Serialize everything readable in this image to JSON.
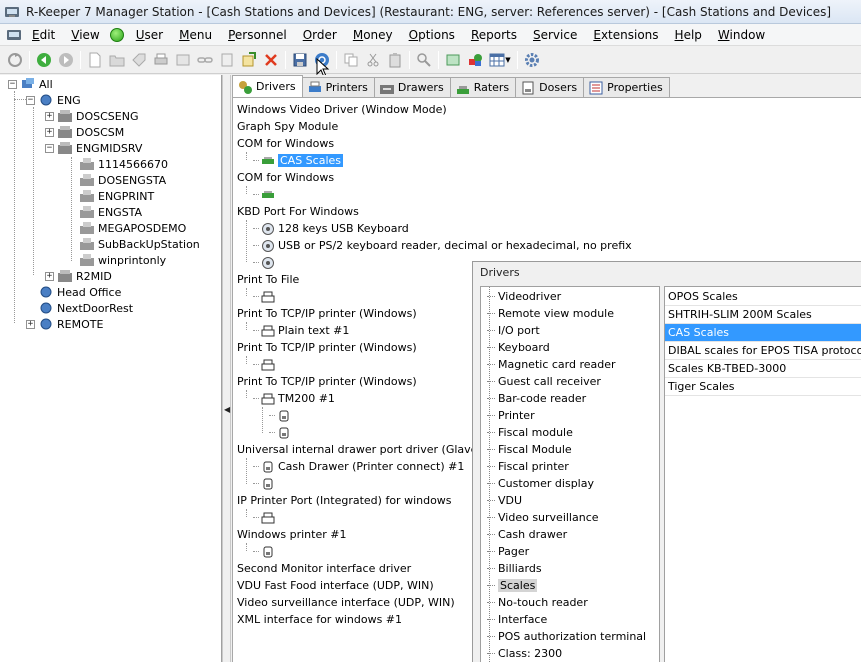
{
  "window": {
    "title": "R-Keeper 7 Manager Station - [Cash Stations and Devices] (Restaurant: ENG, server: References server) - [Cash Stations and Devices]"
  },
  "menu": [
    "Edit",
    "View",
    "User",
    "Menu",
    "Personnel",
    "Order",
    "Money",
    "Options",
    "Reports",
    "Service",
    "Extensions",
    "Help",
    "Window"
  ],
  "tree": {
    "root": "All",
    "nodes": [
      {
        "label": "ENG",
        "level": 1
      },
      {
        "label": "DOSCSENG",
        "level": 2
      },
      {
        "label": "DOSCSM",
        "level": 2
      },
      {
        "label": "ENGMIDSRV",
        "level": 2
      },
      {
        "label": "1114566670",
        "level": 3
      },
      {
        "label": "DOSENGSTA",
        "level": 3
      },
      {
        "label": "ENGPRINT",
        "level": 3
      },
      {
        "label": "ENGSTA",
        "level": 3
      },
      {
        "label": "MEGAPOSDEMO",
        "level": 3
      },
      {
        "label": "SubBackUpStation",
        "level": 3
      },
      {
        "label": "winprintonly",
        "level": 3
      },
      {
        "label": "R2MID",
        "level": 2
      },
      {
        "label": "Head Office",
        "level": 1
      },
      {
        "label": "NextDoorRest",
        "level": 1
      },
      {
        "label": "REMOTE",
        "level": 1
      }
    ]
  },
  "tabs": [
    "Drivers",
    "Printers",
    "Drawers",
    "Raters",
    "Dosers",
    "Properties"
  ],
  "drivers": [
    {
      "label": "Windows Video Driver (Window Mode)",
      "indent": 0
    },
    {
      "label": "Graph Spy Module",
      "indent": 0
    },
    {
      "label": "COM for Windows",
      "indent": 0
    },
    {
      "label": "CAS Scales",
      "indent": 1,
      "icon": "scale",
      "selected": true
    },
    {
      "label": "COM for Windows",
      "indent": 0
    },
    {
      "label": "",
      "indent": 1,
      "icon": "scale"
    },
    {
      "label": "KBD Port For Windows",
      "indent": 0
    },
    {
      "label": "128 keys USB Keyboard",
      "indent": 1,
      "icon": "keyboard"
    },
    {
      "label": "USB or PS/2 keyboard reader, decimal or hexadecimal, no prefix",
      "indent": 1,
      "icon": "keyboard"
    },
    {
      "label": "",
      "indent": 1,
      "icon": "keyboard"
    },
    {
      "label": "Print To File",
      "indent": 0
    },
    {
      "label": "",
      "indent": 1,
      "icon": "printer"
    },
    {
      "label": "Print To TCP/IP printer (Windows)",
      "indent": 0
    },
    {
      "label": "Plain text #1",
      "indent": 1,
      "icon": "printer"
    },
    {
      "label": "Print To TCP/IP printer (Windows)",
      "indent": 0
    },
    {
      "label": "",
      "indent": 1,
      "icon": "printer"
    },
    {
      "label": "Print To TCP/IP printer (Windows)",
      "indent": 0
    },
    {
      "label": "TM200 #1",
      "indent": 1,
      "icon": "printer"
    },
    {
      "label": "",
      "indent": 2,
      "icon": "drawer"
    },
    {
      "label": "",
      "indent": 2,
      "icon": "drawer"
    },
    {
      "label": "Universal internal drawer port driver (Glave, etc.)",
      "indent": 0
    },
    {
      "label": "Cash Drawer (Printer connect) #1",
      "indent": 1,
      "icon": "drawer"
    },
    {
      "label": "",
      "indent": 1,
      "icon": "drawer"
    },
    {
      "label": "IP Printer Port (Integrated) for windows",
      "indent": 0
    },
    {
      "label": "",
      "indent": 1,
      "icon": "printer"
    },
    {
      "label": "Windows printer #1",
      "indent": 0
    },
    {
      "label": "",
      "indent": 1,
      "icon": "drawer"
    },
    {
      "label": "Second Monitor interface driver",
      "indent": 0
    },
    {
      "label": "VDU Fast Food interface (UDP, WIN)",
      "indent": 0
    },
    {
      "label": "Video surveillance interface (UDP, WIN)",
      "indent": 0
    },
    {
      "label": "XML interface for windows #1",
      "indent": 0
    }
  ],
  "dialog": {
    "title": "Drivers",
    "categories": [
      "Videodriver",
      "Remote view module",
      "I/O port",
      "Keyboard",
      "Magnetic card reader",
      "Guest call receiver",
      "Bar-code reader",
      "Printer",
      "Fiscal module",
      "Fiscal Module",
      "Fiscal printer",
      "Customer display",
      "VDU",
      "Video surveillance",
      "Cash drawer",
      "Pager",
      "Billiards",
      "Scales",
      "No-touch reader",
      "Interface",
      "POS authorization terminal",
      "Class: 2300"
    ],
    "selected_category": "Scales",
    "items": [
      "OPOS Scales",
      "SHTRIH-SLIM 200M Scales",
      "CAS Scales",
      "DIBAL scales for EPOS TISA protocol",
      "Scales KB-TBED-3000",
      "Tiger Scales"
    ],
    "selected_item": "CAS Scales"
  }
}
